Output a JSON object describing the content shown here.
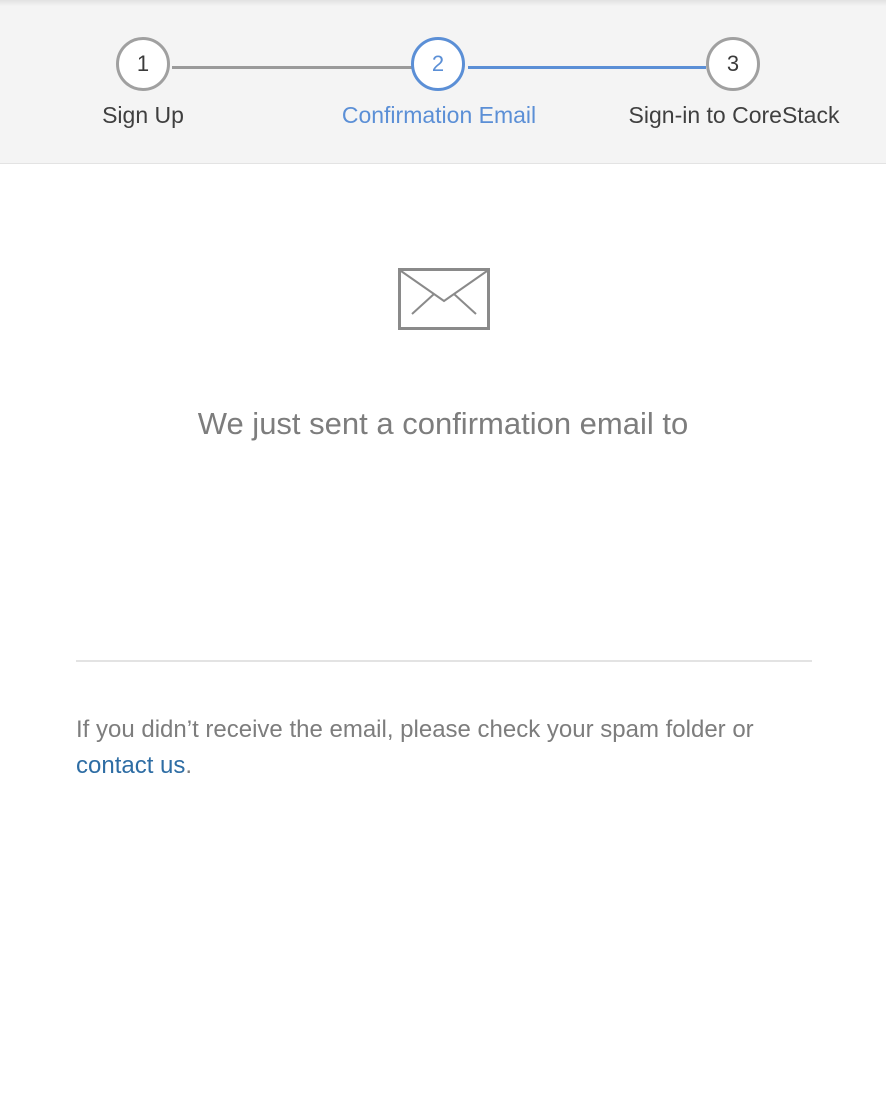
{
  "stepper": {
    "steps": [
      {
        "number": "1",
        "label": "Sign Up",
        "state": "completed"
      },
      {
        "number": "2",
        "label": "Confirmation Email",
        "state": "active"
      },
      {
        "number": "3",
        "label": "Sign-in to CoreStack",
        "state": "pending"
      }
    ],
    "active_color": "#5b8fd6",
    "inactive_color": "#a0a0a0"
  },
  "main": {
    "icon": "envelope-icon",
    "headline": "We just sent a confirmation email to",
    "help_text_prefix": "If you didn’t receive the email, please check your spam folder or ",
    "contact_link": "contact us",
    "help_text_suffix": ".",
    "link_color": "#2e6da4"
  }
}
